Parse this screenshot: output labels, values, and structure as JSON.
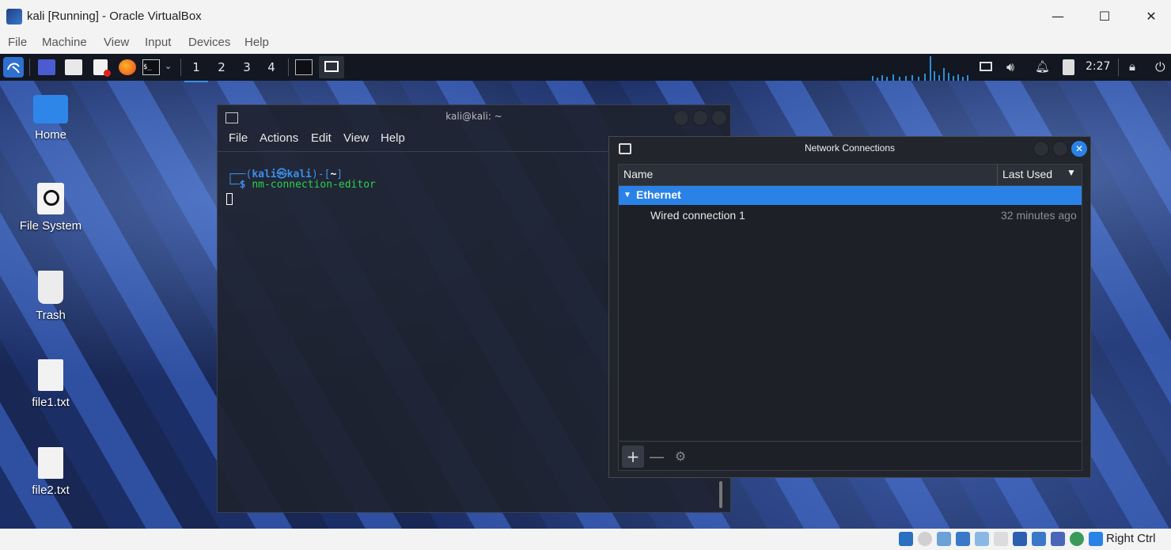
{
  "host": {
    "title": "kali [Running] - Oracle VirtualBox",
    "menu": [
      "File",
      "Machine",
      "View",
      "Input",
      "Devices",
      "Help"
    ],
    "controls": {
      "minimize": "—",
      "maximize": "☐",
      "close": "✕"
    },
    "host_key": "Right Ctrl"
  },
  "panel": {
    "workspaces": [
      "1",
      "2",
      "3",
      "4"
    ],
    "active_workspace": "1",
    "clock": "2:27"
  },
  "desktop": {
    "icons": [
      {
        "label": "Home"
      },
      {
        "label": "File System"
      },
      {
        "label": "Trash"
      },
      {
        "label": "file1.txt"
      },
      {
        "label": "file2.txt"
      }
    ]
  },
  "terminal": {
    "title": "kali@kali: ~",
    "menu": [
      "File",
      "Actions",
      "Edit",
      "View",
      "Help"
    ],
    "prompt_user": "kali",
    "prompt_at": "㉿",
    "prompt_host": "kali",
    "prompt_dir": "~",
    "command": "nm-connection-editor"
  },
  "network_connections": {
    "title": "Network Connections",
    "columns": {
      "name": "Name",
      "last_used": "Last Used"
    },
    "group": "Ethernet",
    "connections": [
      {
        "name": "Wired connection 1",
        "last_used": "32 minutes ago"
      }
    ],
    "toolbar": {
      "add": "+",
      "remove": "—",
      "settings": "⚙"
    }
  },
  "colors": {
    "selection": "#2a82e6",
    "prompt_blue": "#3b8fe8",
    "prompt_green": "#2bd04e"
  }
}
